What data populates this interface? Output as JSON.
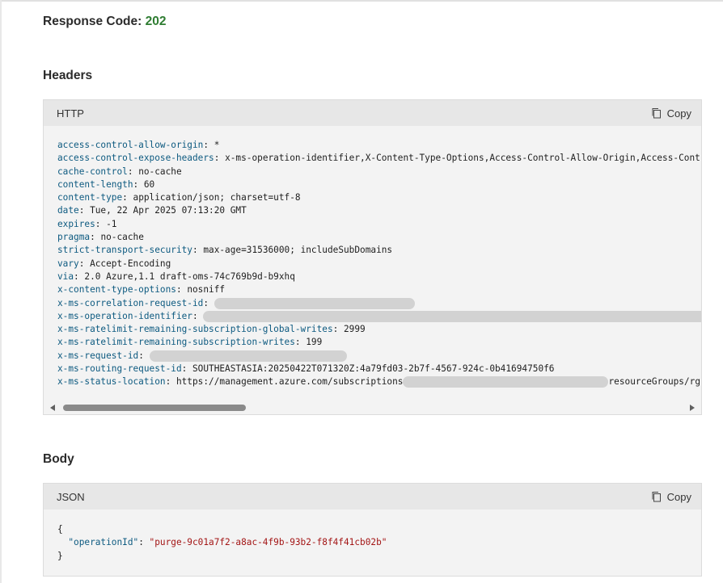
{
  "response": {
    "label": "Response Code:",
    "code": "202"
  },
  "headers_section": {
    "title": "Headers",
    "lang": "HTTP",
    "copy_label": "Copy",
    "lines": [
      {
        "key": "access-control-allow-origin",
        "value": "*"
      },
      {
        "key": "access-control-expose-headers",
        "value": "x-ms-operation-identifier,X-Content-Type-Options,Access-Control-Allow-Origin,Access-Contro"
      },
      {
        "key": "cache-control",
        "value": "no-cache"
      },
      {
        "key": "content-length",
        "value": "60"
      },
      {
        "key": "content-type",
        "value": "application/json; charset=utf-8"
      },
      {
        "key": "date",
        "value": "Tue, 22 Apr 2025 07:13:20 GMT"
      },
      {
        "key": "expires",
        "value": "-1"
      },
      {
        "key": "pragma",
        "value": "no-cache"
      },
      {
        "key": "strict-transport-security",
        "value": "max-age=31536000; includeSubDomains"
      },
      {
        "key": "vary",
        "value": "Accept-Encoding"
      },
      {
        "key": "via",
        "value": "2.0 Azure,1.1 draft-oms-74c769b9d-b9xhq"
      },
      {
        "key": "x-content-type-options",
        "value": "nosniff"
      },
      {
        "key": "x-ms-correlation-request-id",
        "value": ""
      },
      {
        "key": "x-ms-operation-identifier",
        "value": ""
      },
      {
        "key": "x-ms-ratelimit-remaining-subscription-global-writes",
        "value": "2999"
      },
      {
        "key": "x-ms-ratelimit-remaining-subscription-writes",
        "value": "199"
      },
      {
        "key": "x-ms-request-id",
        "value": ""
      },
      {
        "key": "x-ms-routing-request-id",
        "value": "SOUTHEASTASIA:20250422T071320Z:4a79fd03-2b7f-4567-924c-0b41694750f6"
      },
      {
        "key": "x-ms-status-location",
        "value": "https://management.azure.com/subscriptions",
        "value_tail": "resourceGroups/rg-m"
      }
    ]
  },
  "body_section": {
    "title": "Body",
    "lang": "JSON",
    "copy_label": "Copy",
    "open_brace": "{",
    "close_brace": "}",
    "json_key": "\"operationId\"",
    "json_value": "\"purge-9c01a7f2-a8ac-4f9b-93b2-f8f4f41cb02b\""
  },
  "icons": {
    "copy": "copy-icon",
    "scroll_left": "chevron-left-icon",
    "scroll_right": "chevron-right-icon"
  },
  "colors": {
    "success": "#2f7d32",
    "key": "#0d5a80",
    "string": "#a31515"
  }
}
